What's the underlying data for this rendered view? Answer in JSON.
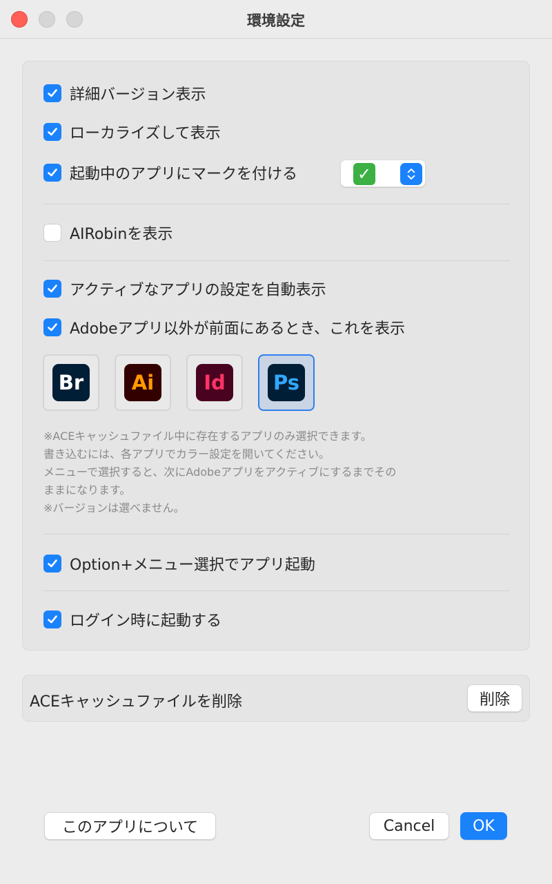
{
  "window": {
    "title": "環境設定"
  },
  "options": {
    "detailed_version": {
      "label": "詳細バージョン表示",
      "checked": true
    },
    "localize": {
      "label": "ローカライズして表示",
      "checked": true
    },
    "mark_running": {
      "label": "起動中のアプリにマークを付ける",
      "checked": true,
      "mark_icon": "green-check-emoji"
    },
    "airobin": {
      "label": "AIRobinを表示",
      "checked": false
    },
    "auto_show_active": {
      "label": "アクティブなアプリの設定を自動表示",
      "checked": true
    },
    "show_when_non_adobe": {
      "label": "Adobeアプリ以外が前面にあるとき、これを表示",
      "checked": true
    },
    "option_menu": {
      "label": "Option+メニュー選択でアプリ起動",
      "checked": true
    },
    "login_launch": {
      "label": "ログイン時に起動する",
      "checked": true
    }
  },
  "apps": [
    {
      "abbr": "Br",
      "name": "bridge",
      "bg": "#001e36",
      "fg": "#ffffff",
      "selected": false
    },
    {
      "abbr": "Ai",
      "name": "illustrator",
      "bg": "#330000",
      "fg": "#ff9a00",
      "selected": false
    },
    {
      "abbr": "Id",
      "name": "indesign",
      "bg": "#49021f",
      "fg": "#ff3366",
      "selected": false
    },
    {
      "abbr": "Ps",
      "name": "photoshop",
      "bg": "#001e36",
      "fg": "#31a8ff",
      "selected": true
    }
  ],
  "note": [
    "※ACEキャッシュファイル中に存在するアプリのみ選択できます。",
    "書き込むには、各アプリでカラー設定を開いてください。",
    "メニューで選択すると、次にAdobeアプリをアクティブにするまでその",
    "ままになります。",
    "※バージョンは選べません。"
  ],
  "cache": {
    "label": "ACEキャッシュファイルを削除",
    "delete_button": "削除"
  },
  "footer": {
    "about_button": "このアプリについて",
    "cancel_button": "Cancel",
    "ok_button": "OK"
  },
  "colors": {
    "accent": "#1a82fb",
    "close": "#ff5f57",
    "selection": "#2f7ff0"
  }
}
